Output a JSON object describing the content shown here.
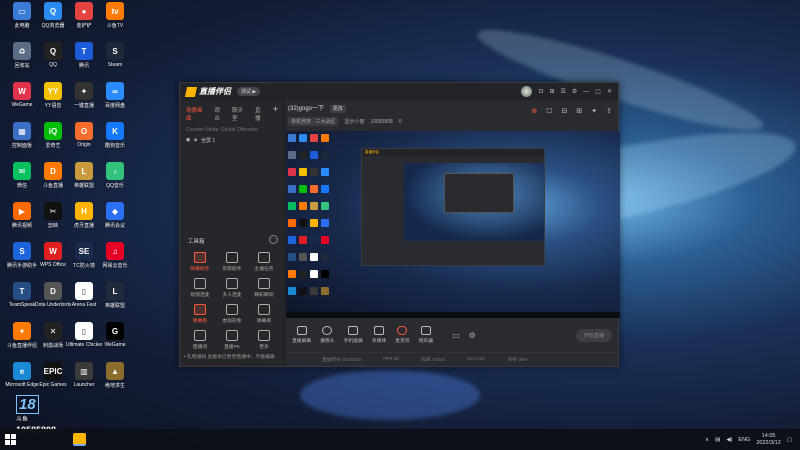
{
  "desktop": {
    "icons": [
      {
        "label": "此电脑",
        "color": "#3a7bd5",
        "glyph": "▭"
      },
      {
        "label": "QQ浏览器",
        "color": "#2a8cf0",
        "glyph": "Q"
      },
      {
        "label": "金铲铲",
        "color": "#e54242",
        "glyph": "●"
      },
      {
        "label": "斗鱼TV",
        "color": "#ff7a00",
        "glyph": "tv"
      },
      {
        "label": "回收站",
        "color": "#5b6d86",
        "glyph": "♻"
      },
      {
        "label": "QQ",
        "color": "#222",
        "glyph": "Q"
      },
      {
        "label": "腾讯",
        "color": "#1e5bd8",
        "glyph": "T"
      },
      {
        "label": "Steam",
        "color": "#1b2838",
        "glyph": "S"
      },
      {
        "label": "WeGame",
        "color": "#e0324b",
        "glyph": "W"
      },
      {
        "label": "YY语音",
        "color": "#f2c200",
        "glyph": "YY"
      },
      {
        "label": "一键直播",
        "color": "#333",
        "glyph": "✦"
      },
      {
        "label": "百度网盘",
        "color": "#2b8cff",
        "glyph": "∞"
      },
      {
        "label": "控制面板",
        "color": "#3b6fc4",
        "glyph": "▦"
      },
      {
        "label": "爱奇艺",
        "color": "#00be06",
        "glyph": "iQ"
      },
      {
        "label": "Origin",
        "color": "#f56c2d",
        "glyph": "O"
      },
      {
        "label": "酷狗音乐",
        "color": "#1677ff",
        "glyph": "K"
      },
      {
        "label": "微信",
        "color": "#07c160",
        "glyph": "✉"
      },
      {
        "label": "斗鱼直播",
        "color": "#ff7a00",
        "glyph": "D"
      },
      {
        "label": "英雄联盟",
        "color": "#c89b3c",
        "glyph": "L"
      },
      {
        "label": "QQ音乐",
        "color": "#31c27c",
        "glyph": "♪"
      },
      {
        "label": "腾讯视频",
        "color": "#ff6a00",
        "glyph": "▶"
      },
      {
        "label": "剪映",
        "color": "#111",
        "glyph": "✂"
      },
      {
        "label": "虎牙直播",
        "color": "#ffb400",
        "glyph": "H"
      },
      {
        "label": "腾讯会议",
        "color": "#2b6ff3",
        "glyph": "◆"
      },
      {
        "label": "腾讯手游助手",
        "color": "#1b64d9",
        "glyph": "S"
      },
      {
        "label": "WPS Office",
        "color": "#e02020",
        "glyph": "W"
      },
      {
        "label": "TC防火墙",
        "color": "#1a2a4a",
        "glyph": "SE"
      },
      {
        "label": "网易云音乐",
        "color": "#e60026",
        "glyph": "♫"
      },
      {
        "label": "TeamSpeak",
        "color": "#274e84",
        "glyph": "T"
      },
      {
        "label": "Dota Underlords",
        "color": "#555",
        "glyph": "D"
      },
      {
        "label": "Arena Fast",
        "color": "#fff",
        "glyph": "▯"
      },
      {
        "label": "英雄联盟",
        "color": "#1f2a3a",
        "glyph": "L"
      },
      {
        "label": "斗鱼直播伴侣",
        "color": "#ff7a00",
        "glyph": "✦"
      },
      {
        "label": "刺激战场",
        "color": "#222",
        "glyph": "✕"
      },
      {
        "label": "Ultimate Chicken",
        "color": "#fff",
        "glyph": "▯"
      },
      {
        "label": "WeGame",
        "color": "#000",
        "glyph": "G"
      },
      {
        "label": "Microsoft Edge",
        "color": "#1a8ad4",
        "glyph": "e"
      },
      {
        "label": "Epic Games",
        "color": "#111",
        "glyph": "EPIC"
      },
      {
        "label": "Launcher",
        "color": "#3a3a3a",
        "glyph": "▥"
      },
      {
        "label": "绝地求生",
        "color": "#8a6d2a",
        "glyph": "▲"
      }
    ]
  },
  "app": {
    "name": "直播伴侣",
    "version_badge": "测试 ▶",
    "title_icons": [
      "⊡",
      "⊞",
      "☰",
      "⚙",
      "—",
      "▢",
      "✕"
    ]
  },
  "left_panel": {
    "tabs": [
      "场景画面",
      "观众",
      "聊天室",
      "直播"
    ],
    "source_line": "Counter-Strike: Global Offensive",
    "scene_name": "全屏 1",
    "tools_title": "工具箱",
    "tools_more": "···",
    "tools": [
      {
        "label": "弹幕助手",
        "hot": true
      },
      {
        "label": "房管助手",
        "hot": false
      },
      {
        "label": "主播任务",
        "hot": false
      },
      {
        "label": "视频连麦",
        "hot": false
      },
      {
        "label": "多人连麦",
        "hot": false
      },
      {
        "label": "精彩瞬间",
        "hot": false
      },
      {
        "label": "弹幕姬",
        "hot": true
      },
      {
        "label": "虚拟形象",
        "hot": false
      },
      {
        "label": "弹幕库",
        "hot": false
      },
      {
        "label": "直播间",
        "hot": false
      },
      {
        "label": "直播PK",
        "hot": false
      },
      {
        "label": "更多",
        "hot": false
      }
    ],
    "notice": "• 礼物通知  此版本已暂停直播中，不能编辑"
  },
  "room": {
    "title": "(32)gogo一下",
    "edit_label": "更改",
    "category": "单机竞技 · 三大战区",
    "cover_label": "显示小窗",
    "room_id": "10585808",
    "fans": "0",
    "right_icons": [
      "⊕",
      "☐",
      "⊟",
      "⊞",
      "✦",
      "⇪"
    ]
  },
  "controls": [
    {
      "label": "直播屏幕"
    },
    {
      "label": "摄像头"
    },
    {
      "label": "手机投屏"
    },
    {
      "label": "多媒体"
    },
    {
      "label": "麦克风"
    },
    {
      "label": "扬声器"
    }
  ],
  "start_live_label": "开始直播",
  "statusbar": [
    "直播时长 00:00:00",
    "FPS 60",
    "码率 0 kb/s",
    "CPU 4%",
    "内存 38%"
  ],
  "taskbar": {
    "lang": "ENG",
    "time": "14:05",
    "date": "2022/3/12"
  },
  "watermark": {
    "logo": "18",
    "site": "斗鱼",
    "number": "10585808"
  }
}
